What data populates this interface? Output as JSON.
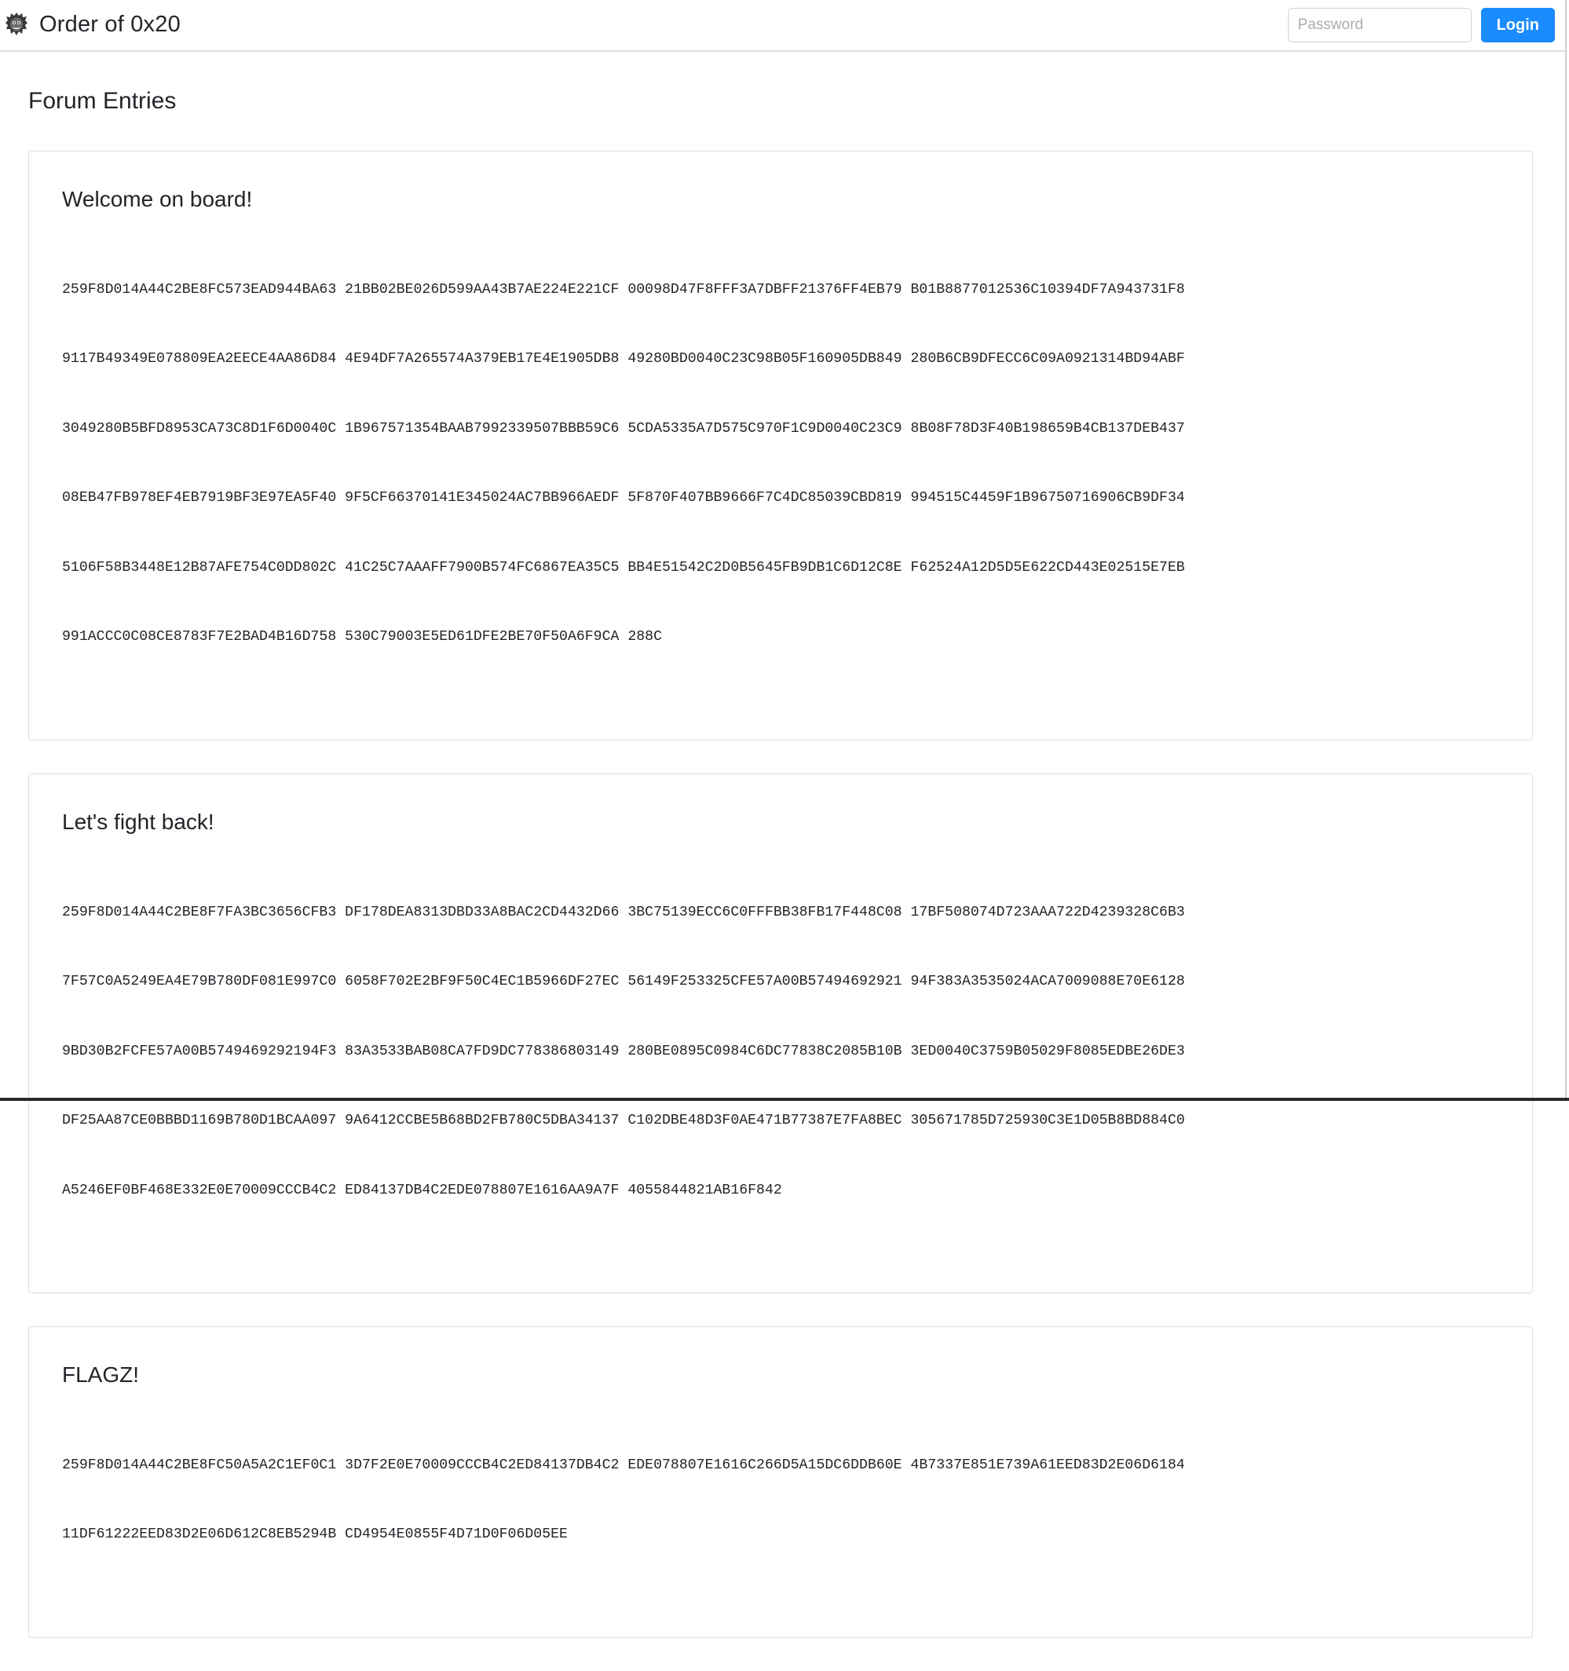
{
  "header": {
    "logo_icon": "hedgehog-logo-icon",
    "brand": "Order of 0x20",
    "password_placeholder": "Password",
    "password_value": "",
    "login_label": "Login",
    "accent_color": "#1a8cff"
  },
  "page": {
    "title": "Forum Entries"
  },
  "entries": [
    {
      "title": "Welcome on board!",
      "lines": [
        "259F8D014A44C2BE8FC573EAD944BA63 21BB02BE026D599AA43B7AE224E221CF 00098D47F8FFF3A7DBFF21376FF4EB79 B01B8877012536C10394DF7A943731F8",
        "9117B49349E078809EA2EECE4AA86D84 4E94DF7A265574A379EB17E4E1905DB8 49280BD0040C23C98B05F160905DB849 280B6CB9DFECC6C09A0921314BD94ABF",
        "3049280B5BFD8953CA73C8D1F6D0040C 1B967571354BAAB7992339507BBB59C6 5CDA5335A7D575C970F1C9D0040C23C9 8B08F78D3F40B198659B4CB137DEB437",
        "08EB47FB978EF4EB7919BF3E97EA5F40 9F5CF66370141E345024AC7BB966AEDF 5F870F407BB9666F7C4DC85039CBD819 994515C4459F1B96750716906CB9DF34",
        "5106F58B3448E12B87AFE754C0DD802C 41C25C7AAAFF7900B574FC6867EA35C5 BB4E51542C2D0B5645FB9DB1C6D12C8E F62524A12D5D5E622CD443E02515E7EB",
        "991ACCC0C08CE8783F7E2BAD4B16D758 530C79003E5ED61DFE2BE70F50A6F9CA 288C"
      ]
    },
    {
      "title": "Let's fight back!",
      "lines": [
        "259F8D014A44C2BE8F7FA3BC3656CFB3 DF178DEA8313DBD33A8BAC2CD4432D66 3BC75139ECC6C0FFFBB38FB17F448C08 17BF508074D723AAA722D4239328C6B3",
        "7F57C0A5249EA4E79B780DF081E997C0 6058F702E2BF9F50C4EC1B5966DF27EC 56149F253325CFE57A00B57494692921 94F383A3535024ACA7009088E70E6128",
        "9BD30B2FCFE57A00B5749469292194F3 83A3533BAB08CA7FD9DC778386803149 280BE0895C0984C6DC77838C2085B10B 3ED0040C3759B05029F8085EDBE26DE3",
        "DF25AA87CE0BBBD1169B780D1BCAA097 9A6412CCBE5B68BD2FB780C5DBA34137 C102DBE48D3F0AE471B77387E7FA8BEC 305671785D725930C3E1D05B8BD884C0",
        "A5246EF0BF468E332E0E70009CCCB4C2 ED84137DB4C2EDE078807E1616AA9A7F 4055844821AB16F842"
      ]
    },
    {
      "title": "FLAGZ!",
      "lines": [
        "259F8D014A44C2BE8FC50A5A2C1EF0C1 3D7F2E0E70009CCCB4C2ED84137DB4C2 EDE078807E1616C266D5A15DC6DDB60E 4B7337E851E739A61EED83D2E06D6184",
        "11DF61222EED83D2E06D612C8EB5294B CD4954E0855F4D71D0F06D05EE"
      ]
    }
  ]
}
